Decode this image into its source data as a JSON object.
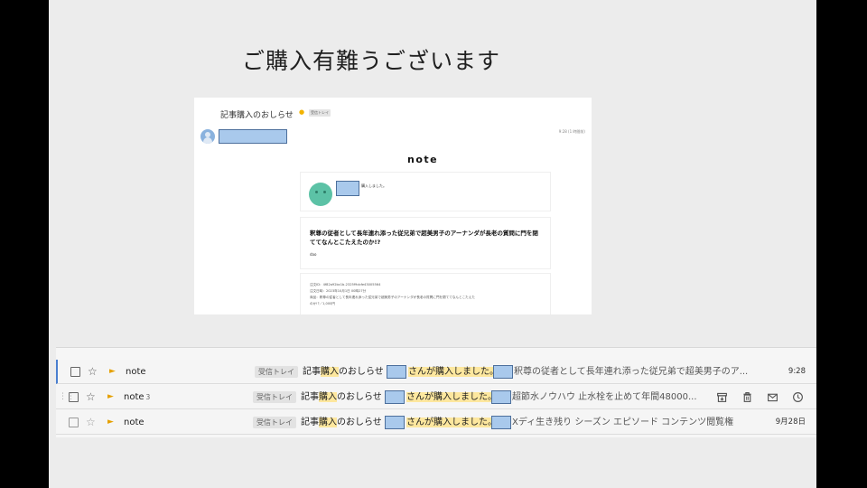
{
  "heading": "ご購入有難うございます",
  "email": {
    "subject": "記事購入のおしらせ",
    "label": "受信トレイ",
    "date": "9:28 (1 時間前)",
    "logo": "note",
    "purchase_text": "購入しました。",
    "article_title": "釈尊の従者として長年連れ添った従兄弟で超美男子のアーナンダが長老の質問に門を閉ててなんとこたえたのか!?",
    "article_author": "dao",
    "details": [
      "注文ID：4f82a92bc1b-2325f9cbfe43005564",
      "注文日時：2023年10月1日 00時27分",
      "商品：釈尊の従者として長年連れ添った従兄弟で超美男子のアーナンダが長老の質問に門を閉ててなんとこたえた",
      "のか!?／1,000円"
    ]
  },
  "inbox": {
    "rows": [
      {
        "sender": "note",
        "count": "",
        "label": "受信トレイ",
        "subject_pre": "記事",
        "subject_hl": "購入",
        "subject_post": "のおしらせ",
        "bought": "さんが購入しました。",
        "snippet": "釈尊の従者として長年連れ添った従兄弟で超美男子のア...",
        "time": "9:28"
      },
      {
        "sender": "note",
        "count": "3",
        "label": "受信トレイ",
        "subject_pre": "記事",
        "subject_hl": "購入",
        "subject_post": "のおしらせ",
        "bought": "さんが購入しました。",
        "snippet": "超節水ノウハウ 止水栓を止めて年間48000...",
        "time": ""
      },
      {
        "sender": "note",
        "count": "",
        "label": "受信トレイ",
        "subject_pre": "記事",
        "subject_hl": "購入",
        "subject_post": "のおしらせ",
        "bought": "さんが購入しました。",
        "snippet": "Xディ生き残り シーズン エピソード コンテンツ閲覧権",
        "time": "9月28日"
      }
    ]
  },
  "icons": {
    "star": "star-icon",
    "important": "important-marker-icon",
    "archive": "archive-icon",
    "delete": "trash-icon",
    "mark_unread": "envelope-icon",
    "snooze": "clock-icon"
  },
  "colors": {
    "highlight": "#fde79e",
    "redaction": "#a9c9ec",
    "important": "#e5a000",
    "selected_bar": "#4a7fd0",
    "avatar_green": "#5cc2a6"
  }
}
